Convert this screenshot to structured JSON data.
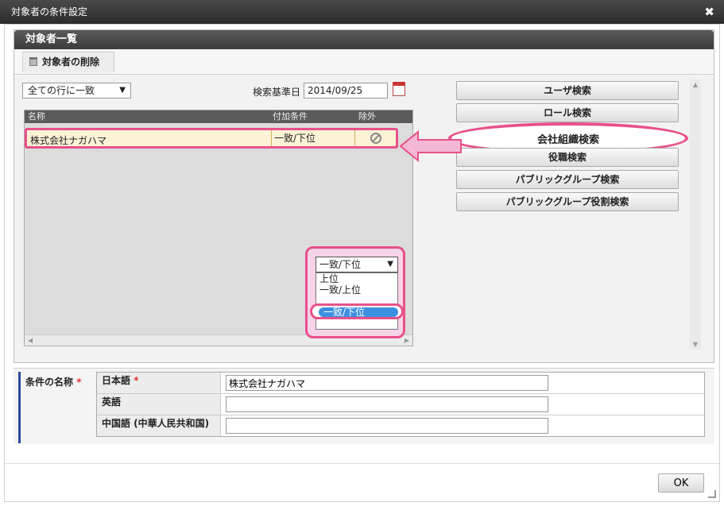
{
  "window": {
    "title": "対象者の条件設定"
  },
  "panel": {
    "title": "対象者一覧",
    "delete_label": "対象者の削除"
  },
  "filter": {
    "match_select": "全ての行に一致",
    "date_label": "検索基準日",
    "date_value": "2014/09/25"
  },
  "grid": {
    "columns": [
      "名称",
      "付加条件",
      "除外"
    ],
    "rows": [
      {
        "name": "株式会社ナガハマ",
        "condition": "一致/下位"
      }
    ]
  },
  "dropdown": {
    "current": "一致/下位",
    "options": [
      "上位",
      "一致/上位",
      "一致/下位"
    ],
    "selected": "一致/下位"
  },
  "search_buttons": {
    "user": "ユーザ検索",
    "role": "ロール検索",
    "org": "会社組織検索",
    "post": "役職検索",
    "public_group": "パブリックグループ検索",
    "public_group_role": "パブリックグループ役割検索"
  },
  "form": {
    "label": "条件の名称",
    "required_mark": "*",
    "rows": [
      {
        "label": "日本語",
        "value": "株式会社ナガハマ",
        "required": true
      },
      {
        "label": "英語",
        "value": ""
      },
      {
        "label": "中国語 (中華人民共和国)",
        "value": ""
      }
    ]
  },
  "footer": {
    "ok_label": "OK"
  },
  "colors": {
    "highlight": "#e8508a",
    "titlebar": "#2b2b2b",
    "selection": "#3d8fe0"
  }
}
